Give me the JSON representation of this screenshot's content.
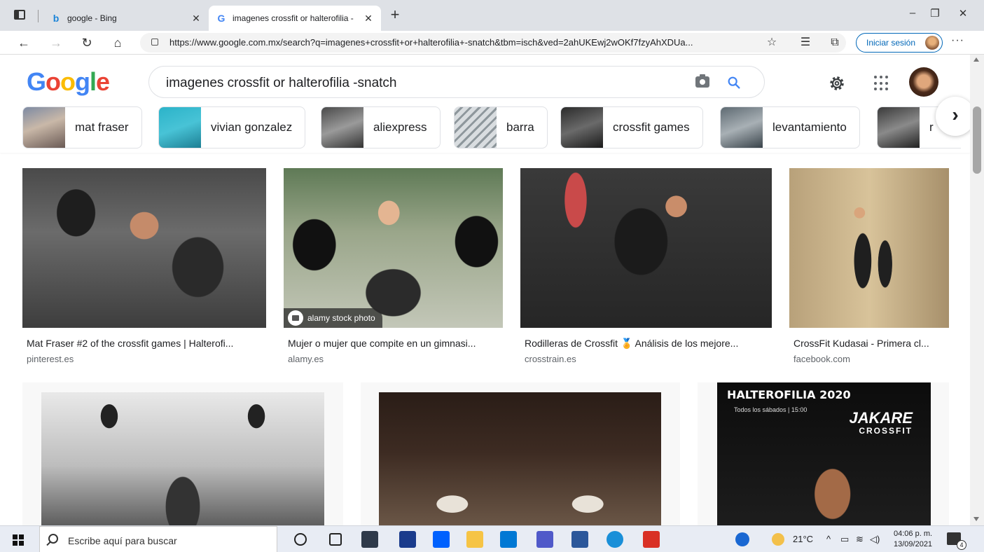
{
  "browser": {
    "tabs": [
      {
        "title": "google - Bing",
        "favicon": "bing-icon"
      },
      {
        "title": "imagenes crossfit or halterofilia -",
        "favicon": "google-icon"
      }
    ],
    "new_tab": "+",
    "window_controls": {
      "minimize": "–",
      "restore": "❐",
      "close": "✕"
    },
    "url": "https://www.google.com.mx/search?q=imagenes+crossfit+or+halterofilia+-snatch&tbm=isch&ved=2ahUKEwj2wOKf7fzyAhXDUa...",
    "signin_label": "Iniciar sesión",
    "more": "···"
  },
  "google": {
    "logo": [
      "G",
      "o",
      "o",
      "g",
      "l",
      "e"
    ],
    "query": "imagenes crossfit or halterofilia -snatch",
    "chips": [
      {
        "label": "mat fraser"
      },
      {
        "label": "vivian gonzalez"
      },
      {
        "label": "aliexpress"
      },
      {
        "label": "barra"
      },
      {
        "label": "crossfit games"
      },
      {
        "label": "levantamiento"
      },
      {
        "label": "r"
      }
    ]
  },
  "results": [
    {
      "title": "Mat Fraser #2 of the crossfit games | Halterofi...",
      "source": "pinterest.es"
    },
    {
      "title": "Mujer o mujer que compite en un gimnasi...",
      "source": "alamy.es",
      "badge": "alamy stock photo"
    },
    {
      "title": "Rodilleras de Crossfit 🏅 Análisis de los mejore...",
      "source": "crosstrain.es"
    },
    {
      "title": "CrossFit Kudasai - Primera cl...",
      "source": "facebook.com"
    },
    {
      "title": "",
      "source": ""
    },
    {
      "title": "",
      "source": ""
    },
    {
      "title": "",
      "source": "",
      "poster": {
        "headline": "HALTEROFILIA 2020",
        "sub": "Todos los sábados  |  15:00",
        "brand": "JAKARE",
        "brand_sub": "CROSSFIT"
      }
    }
  ],
  "taskbar": {
    "search_placeholder": "Escribe aquí para buscar",
    "weather": "21°C",
    "time": "04:06 p. m.",
    "date": "13/09/2021",
    "notifications": "4"
  },
  "colors": {
    "google_blue": "#4285f4",
    "edge_blue": "#0067b8"
  }
}
